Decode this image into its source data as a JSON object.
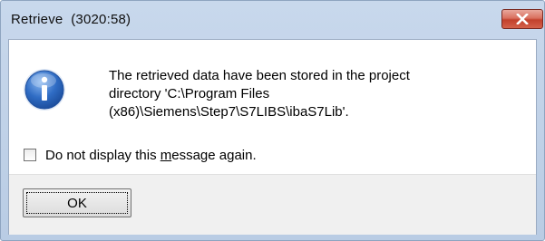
{
  "window": {
    "title": "Retrieve",
    "title_suffix": "(3020:58)"
  },
  "message": {
    "line1": "The retrieved data have been stored in the project",
    "line2": "directory 'C:\\Program Files",
    "line3": "(x86)\\Siemens\\Step7\\S7LIBS\\ibaS7Lib'."
  },
  "checkbox": {
    "checked": false,
    "label_before": "Do not display this ",
    "label_mnemonic": "m",
    "label_after": "essage again."
  },
  "buttons": {
    "ok_label": "OK"
  },
  "icons": {
    "info": "info-icon",
    "close": "close-icon"
  },
  "colors": {
    "close_button": "#c2402c",
    "info_icon": "#2f6cc4"
  }
}
